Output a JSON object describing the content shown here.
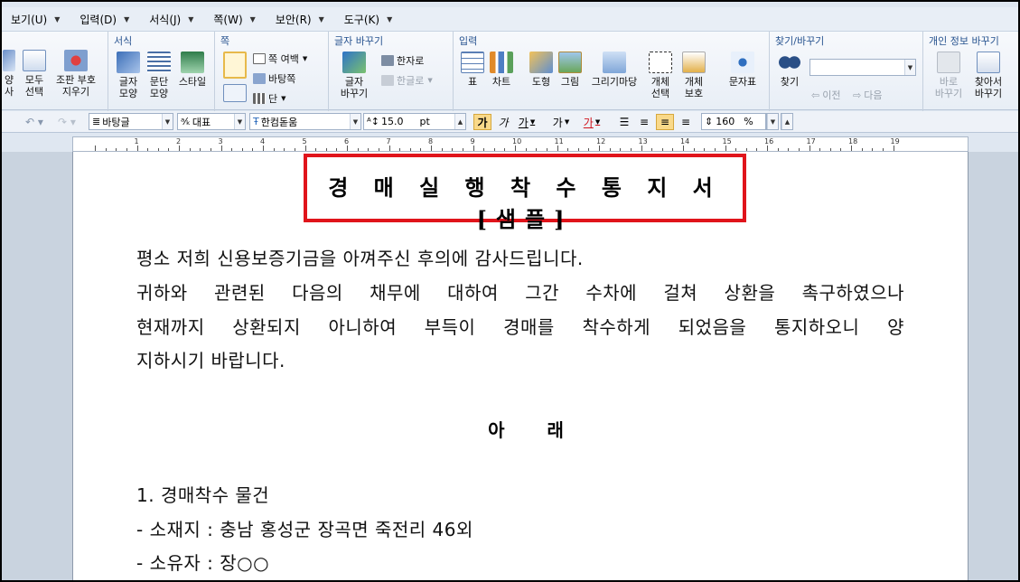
{
  "menu": [
    {
      "label": "보기(U)"
    },
    {
      "label": "입력(D)"
    },
    {
      "label": "서식(J)"
    },
    {
      "label": "쪽(W)"
    },
    {
      "label": "보안(R)"
    },
    {
      "label": "도구(K)"
    }
  ],
  "ribbon": {
    "left_partial": {
      "a1": "양",
      "a2": "사",
      "b1": "모두",
      "b2": "선택",
      "c1": "조판 부호",
      "c2": "지우기"
    },
    "format_group": {
      "title": "서식",
      "char_shape1": "글자",
      "char_shape2": "모양",
      "para_shape1": "문단",
      "para_shape2": "모양",
      "style": "스타일"
    },
    "page_group": {
      "title": "쪽",
      "margin": "쪽 여백",
      "background": "바탕쪽",
      "columns": "단"
    },
    "replace_group": {
      "title": "글자 바꾸기",
      "hanja": "한자로",
      "hangul": "한글로",
      "replace1": "글자",
      "replace2": "바꾸기"
    },
    "insert_group": {
      "title": "입력",
      "table": "표",
      "chart": "차트",
      "shape": "도형",
      "picture": "그림",
      "gallery": "그리기마당",
      "obj_sel1": "개체",
      "obj_sel2": "선택",
      "obj_prot1": "개체",
      "obj_prot2": "보호",
      "symbol": "문자표"
    },
    "find_group": {
      "title": "찾기/바꾸기",
      "find": "찾기",
      "prev": "이전",
      "next": "다음"
    },
    "privacy_group": {
      "title": "개인 정보 바꾸기",
      "direct1": "바로",
      "direct2": "바꾸기",
      "findrep1": "찾아서",
      "findrep2": "바꾸기"
    }
  },
  "format_toolbar": {
    "style": "바탕글",
    "lang": "대표",
    "font": "한컴돋움",
    "size": "15.0",
    "unit": "pt",
    "bold": "가",
    "italic": "가",
    "underline": "가",
    "strike": "가",
    "color": "가",
    "line_spacing": "160",
    "percent": "%"
  },
  "ruler_numbers": [
    "1",
    "2",
    "3",
    "4",
    "5",
    "6",
    "7",
    "8",
    "9",
    "10",
    "11",
    "12",
    "13",
    "14",
    "15",
    "16",
    "17",
    "18",
    "19"
  ],
  "document": {
    "title": "경 매 실 행 착 수 통 지 서[샘플]",
    "para1_line1": "평소 저희 신용보증기금을 아껴주신 후의에 감사드립니다.",
    "para1_line2": "귀하와 관련된 다음의 채무에 대하여 그간 수차에 걸쳐 상환을 촉구하였으나",
    "para1_line3": "현재까지 상환되지 아니하여 부득이 경매를 착수하게 되었음을 통지하오니 양",
    "para1_line4": "지하시기 바랍니다.",
    "heading": "아 래",
    "item1": "1. 경매착수 물건",
    "item1_a": " - 소재지 : 충남 홍성군 장곡면 죽전리 46외",
    "item1_b": " - 소유자 : 장○○"
  }
}
